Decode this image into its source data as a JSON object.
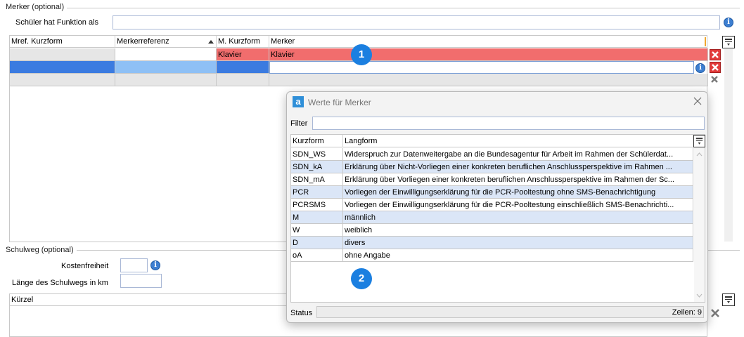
{
  "merker_section": {
    "title": "Merker (optional)",
    "schueler_label": "Schüler hat Funktion als",
    "schueler_value": "",
    "columns": [
      "Mref. Kurzform",
      "Merkerreferenz",
      "M. Kurzform",
      "Merker"
    ],
    "rows": [
      {
        "mref": "",
        "merkerreferenz": "",
        "m_kurzform": "Klavier",
        "merker": "Klavier"
      },
      {
        "mref": "",
        "merkerreferenz": "",
        "m_kurzform": "",
        "merker": ""
      }
    ]
  },
  "schulweg_section": {
    "title": "Schulweg (optional)",
    "kostenfreiheit_label": "Kostenfreiheit",
    "laenge_label": "Länge des Schulwegs in km",
    "kuerzel_header": "Kürzel"
  },
  "badges": {
    "one": "1",
    "two": "2"
  },
  "dialog": {
    "logo": "a",
    "title": "Werte für Merker",
    "filter_label": "Filter",
    "filter_value": "",
    "columns": [
      "Kurzform",
      "Langform"
    ],
    "items": [
      {
        "kurz": "SDN_WS",
        "lang": "Widerspruch zur Datenweitergabe an die Bundesagentur für Arbeit im Rahmen der Schülerdat..."
      },
      {
        "kurz": "SDN_kA",
        "lang": "Erklärung über Nicht-Vorliegen einer konkreten beruflichen Anschlussperspektive im Rahmen ..."
      },
      {
        "kurz": "SDN_mA",
        "lang": "Erklärung über Vorliegen einer konkreten beruflichen Anschlussperspektive im Rahmen der Sc..."
      },
      {
        "kurz": "PCR",
        "lang": "Vorliegen der Einwilligungserklärung für die PCR-Pooltestung ohne SMS-Benachrichtigung"
      },
      {
        "kurz": "PCRSMS",
        "lang": "Vorliegen der Einwilligungserklärung für die PCR-Pooltestung einschließlich SMS-Benachrichti..."
      },
      {
        "kurz": "M",
        "lang": "männlich"
      },
      {
        "kurz": "W",
        "lang": "weiblich"
      },
      {
        "kurz": "D",
        "lang": "divers"
      },
      {
        "kurz": "oA",
        "lang": "ohne Angabe"
      }
    ],
    "status_label": "Status",
    "zeilen": "Zeilen: 9"
  },
  "colors": {
    "accent_red": "#f16d6d",
    "selected_blue": "#3b7be0",
    "row_alt": "#dbe6f7",
    "badge": "#1b7fe0"
  }
}
